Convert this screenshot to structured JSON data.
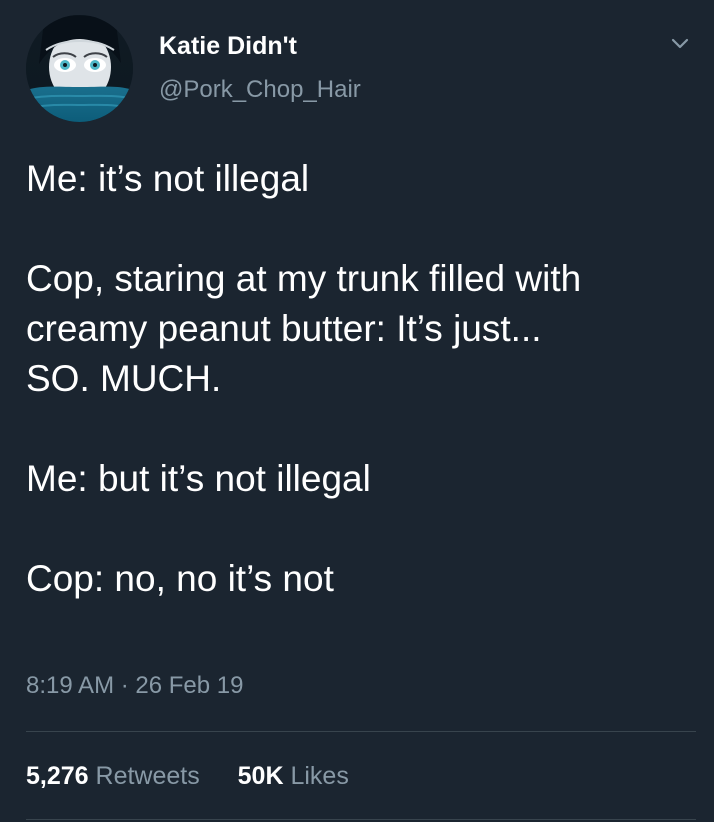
{
  "user": {
    "name": "Katie Didn't",
    "handle": "@Pork_Chop_Hair"
  },
  "tweet": {
    "lines": [
      "Me: it’s not illegal",
      "",
      "Cop, staring at my trunk filled with",
      "creamy peanut butter: It’s just...",
      "SO. MUCH.",
      "",
      "Me: but it’s not illegal",
      "",
      "Cop: no, no it’s not"
    ],
    "timestamp": "8:19 AM · 26 Feb 19"
  },
  "stats": {
    "retweets_count": "5,276",
    "retweets_label": "Retweets",
    "likes_count": "50K",
    "likes_label": "Likes"
  },
  "icons": {
    "avatar": "avatar-image",
    "menu": "chevron-down-icon"
  },
  "colors": {
    "background": "#1b2530",
    "text_primary": "#ffffff",
    "text_secondary": "#8899a6",
    "divider": "#38444d"
  }
}
